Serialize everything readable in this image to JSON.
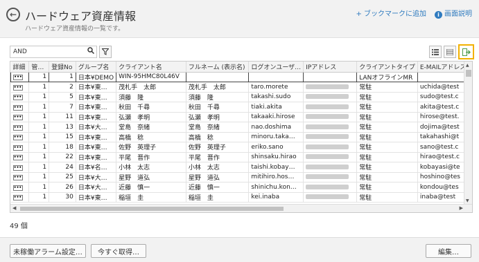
{
  "header": {
    "title": "ハードウェア資産情報",
    "subtitle": "ハードウェア資産情報の一覧です。",
    "bookmark_label": "+ ブックマークに追加",
    "help_label": "画面説明"
  },
  "toolbar": {
    "search_value": "AND"
  },
  "table": {
    "columns": [
      "詳細",
      "管…",
      "登録No",
      "グループ名",
      "クライアント名",
      "フルネーム (表示名)",
      "ログオンユーザ…",
      "IPアドレス",
      "クライアントタイプ",
      "E-MAILアドレス"
    ],
    "rows": [
      {
        "kanri": "1",
        "no": "1",
        "group": "日本¥DEMO",
        "client": "WIN-95HMC80L46V",
        "fullname": "",
        "logon": "",
        "type": "LANオフラインMR",
        "email": ""
      },
      {
        "kanri": "1",
        "no": "2",
        "group": "日本¥東…",
        "client": "茂札手　太郎",
        "fullname": "茂札手　太郎",
        "logon": "taro.morete",
        "type": "常駐",
        "email": "uchida@test"
      },
      {
        "kanri": "1",
        "no": "5",
        "group": "日本¥東…",
        "client": "須藤　隆",
        "fullname": "須藤　隆",
        "logon": "takashi.sudo",
        "type": "常駐",
        "email": "sudo@test.c"
      },
      {
        "kanri": "1",
        "no": "7",
        "group": "日本¥東…",
        "client": "秋田　千尋",
        "fullname": "秋田　千尋",
        "logon": "tiaki.akita",
        "type": "常駐",
        "email": "akita@test.c"
      },
      {
        "kanri": "1",
        "no": "11",
        "group": "日本¥東…",
        "client": "弘瀬　孝明",
        "fullname": "弘瀬　孝明",
        "logon": "takaaki.hirose",
        "type": "常駐",
        "email": "hirose@test."
      },
      {
        "kanri": "1",
        "no": "13",
        "group": "日本¥大…",
        "client": "堂島　奈緒",
        "fullname": "堂島　奈緒",
        "logon": "nao.doshima",
        "type": "常駐",
        "email": "dojima@test"
      },
      {
        "kanri": "1",
        "no": "15",
        "group": "日本¥東…",
        "client": "高橋　稔",
        "fullname": "高橋　稔",
        "logon": "minoru.taka…",
        "type": "常駐",
        "email": "takahashi@t"
      },
      {
        "kanri": "1",
        "no": "18",
        "group": "日本¥東…",
        "client": "佐野　英理子",
        "fullname": "佐野　英理子",
        "logon": "eriko.sano",
        "type": "常駐",
        "email": "sano@test.c"
      },
      {
        "kanri": "1",
        "no": "22",
        "group": "日本¥東…",
        "client": "平尾　晋作",
        "fullname": "平尾　晋作",
        "logon": "shinsaku.hirao",
        "type": "常駐",
        "email": "hirao@test.c"
      },
      {
        "kanri": "1",
        "no": "24",
        "group": "日本¥名…",
        "client": "小林　太志",
        "fullname": "小林　太志",
        "logon": "taishi.kobay…",
        "type": "常駐",
        "email": "kobayasi@te"
      },
      {
        "kanri": "1",
        "no": "25",
        "group": "日本¥大…",
        "client": "星野　道弘",
        "fullname": "星野　道弘",
        "logon": "mitihiro.hos…",
        "type": "常駐",
        "email": "hoshino@tes"
      },
      {
        "kanri": "1",
        "no": "26",
        "group": "日本¥大…",
        "client": "近藤　慎一",
        "fullname": "近藤　慎一",
        "logon": "shinichu.kon…",
        "type": "常駐",
        "email": "kondou@tes"
      },
      {
        "kanri": "1",
        "no": "30",
        "group": "日本¥東…",
        "client": "稲垣　圭",
        "fullname": "稲垣　圭",
        "logon": "kei.inaba",
        "type": "常駐",
        "email": "inaba@test"
      }
    ]
  },
  "count_label": "49 個",
  "footer": {
    "alarm_label": "未稼働アラーム設定…",
    "acquire_label": "今すぐ取得…",
    "edit_label": "編集…"
  }
}
